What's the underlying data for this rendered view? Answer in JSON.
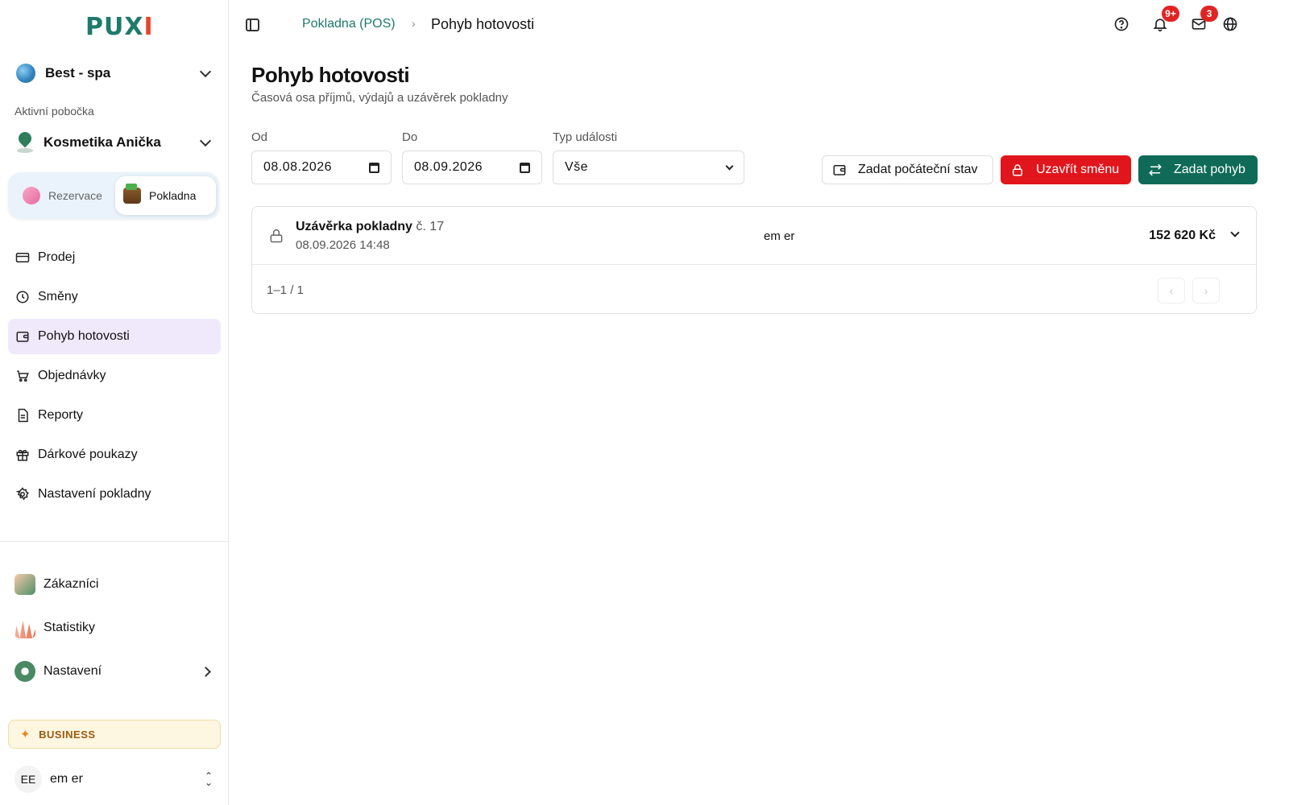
{
  "sidebar": {
    "logo_main": "PUX",
    "logo_accent": "I",
    "organization": "Best - spa",
    "branch_label": "Aktivní pobočka",
    "branch_name": "Kosmetika Anička",
    "switcher": [
      {
        "label": "Rezervace",
        "active": false
      },
      {
        "label": "Pokladna",
        "active": true
      }
    ],
    "nav": [
      {
        "label": "Prodej",
        "icon": "card-icon"
      },
      {
        "label": "Směny",
        "icon": "clock-icon"
      },
      {
        "label": "Pohyb hotovosti",
        "icon": "wallet-icon",
        "active": true
      },
      {
        "label": "Objednávky",
        "icon": "cart-icon"
      },
      {
        "label": "Reporty",
        "icon": "document-icon"
      },
      {
        "label": "Dárkové poukazy",
        "icon": "gift-icon"
      },
      {
        "label": "Nastavení pokladny",
        "icon": "gear-icon"
      }
    ],
    "nav_secondary": [
      {
        "label": "Zákazníci",
        "icon": "customers-icon"
      },
      {
        "label": "Statistiky",
        "icon": "statistics-icon"
      },
      {
        "label": "Nastavení",
        "icon": "settings-icon"
      }
    ],
    "plan_badge": "BUSINESS",
    "user": {
      "initials": "EE",
      "name": "em er"
    }
  },
  "topbar": {
    "breadcrumb_parent": "Pokladna (POS)",
    "breadcrumb_current": "Pohyb hotovosti",
    "notifications_badge": "9+",
    "messages_badge": "3"
  },
  "page": {
    "title": "Pohyb hotovosti",
    "subtitle": "Časová osa příjmů, výdajů a uzávěrek pokladny"
  },
  "filters": {
    "from_label": "Od",
    "from_value": "08.08.2026",
    "to_label": "Do",
    "to_value": "08.09.2026",
    "type_label": "Typ události",
    "type_value": "Vše"
  },
  "actions": {
    "initial_state": "Zadat počáteční stav",
    "close_shift": "Uzavřít směnu",
    "add_movement": "Zadat pohyb"
  },
  "entries": [
    {
      "title": "Uzávěrka pokladny",
      "number": "č. 17",
      "datetime": "08.09.2026 14:48",
      "user": "em er",
      "amount": "152 620 Kč"
    }
  ],
  "pagination": {
    "text": "1–1 / 1"
  },
  "colors": {
    "brand": "#1f7a6a",
    "danger": "#e0161c",
    "primary": "#0f6b58",
    "active_nav": "#f0e9fc"
  }
}
